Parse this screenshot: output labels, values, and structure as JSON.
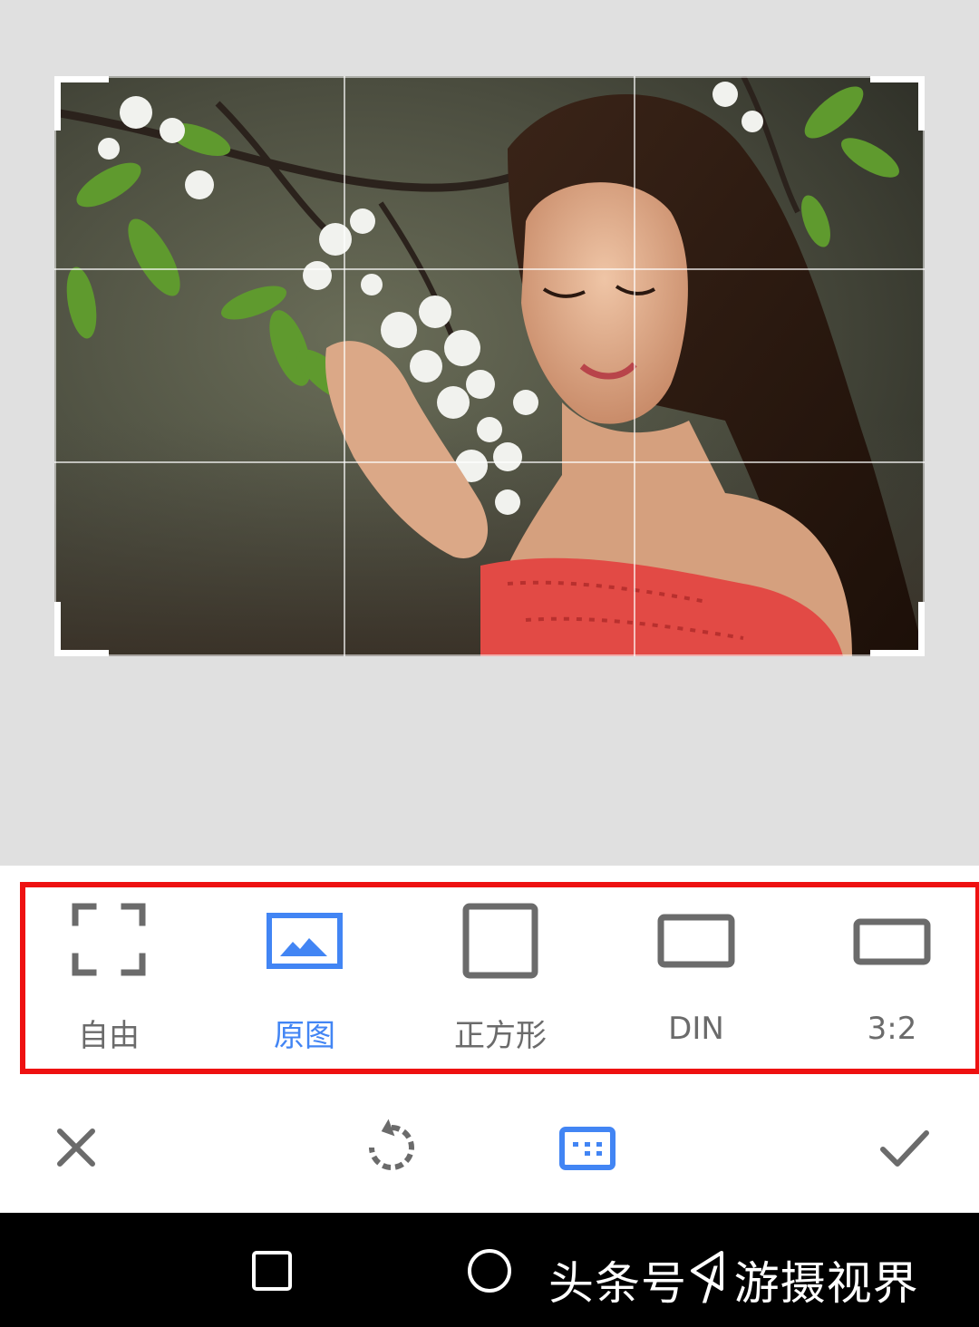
{
  "aspect_options": [
    {
      "label": "自由",
      "icon": "free-crop-icon",
      "selected": false
    },
    {
      "label": "原图",
      "icon": "original-image-icon",
      "selected": true
    },
    {
      "label": "正方形",
      "icon": "square-icon",
      "selected": false
    },
    {
      "label": "DIN",
      "icon": "din-ratio-icon",
      "selected": false
    },
    {
      "label": "3:2",
      "icon": "ratio-3-2-icon",
      "selected": false
    }
  ],
  "actions": {
    "cancel_icon": "close-icon",
    "rotate_icon": "rotate-icon",
    "aspect_icon": "aspect-ratio-icon",
    "confirm_icon": "check-icon"
  },
  "system_nav": {
    "recents_icon": "recents-square-icon",
    "home_icon": "home-circle-icon",
    "back_icon": "back-triangle-icon"
  },
  "watermark": "头条号 / 游摄视界",
  "colors": {
    "accent": "#4285f4",
    "highlight": "#ee1111",
    "icon_gray": "#6b6b6b",
    "canvas_bg": "#e0e0e0"
  }
}
